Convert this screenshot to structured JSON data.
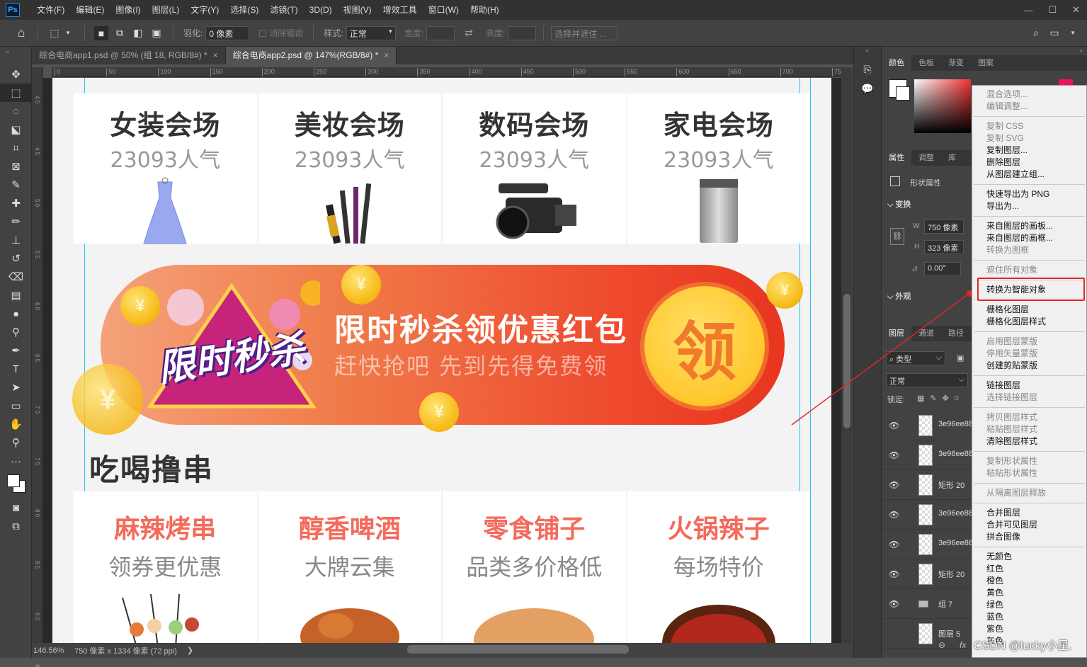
{
  "menubar": {
    "logo": "Ps",
    "items": [
      "文件(F)",
      "编辑(E)",
      "图像(I)",
      "图层(L)",
      "文字(Y)",
      "选择(S)",
      "滤镜(T)",
      "3D(D)",
      "视图(V)",
      "增效工具",
      "窗口(W)",
      "帮助(H)"
    ],
    "min": "—",
    "max": "☐",
    "close": "✕"
  },
  "options": {
    "feather_label": "羽化:",
    "feather_value": "0 像素",
    "antialias_label": "消除锯齿",
    "style_label": "样式:",
    "style_value": "正常",
    "width_label": "宽度:",
    "height_label": "高度:",
    "select_mask": "选择并遮住 ..."
  },
  "tabs": [
    {
      "label": "综合电商app1.psd @ 50% (组 18, RGB/8#) *",
      "close": "×"
    },
    {
      "label": "综合电商app2.psd @ 147%(RGB/8#) *",
      "close": "×"
    }
  ],
  "ruler_top": [
    "0",
    "50",
    "100",
    "150",
    "200",
    "250",
    "300",
    "350",
    "400",
    "450",
    "500",
    "550",
    "600",
    "650",
    "700",
    "75"
  ],
  "ruler_left": [
    "4\n0",
    "4\n5",
    "5\n0",
    "5\n5",
    "6\n0",
    "6\n5",
    "7\n0",
    "7\n5",
    "8\n0",
    "8\n5",
    "9\n0",
    "9"
  ],
  "canvas": {
    "categories": [
      {
        "title": "女装会场",
        "sub": "23093人气"
      },
      {
        "title": "美妆会场",
        "sub": "23093人气"
      },
      {
        "title": "数码会场",
        "sub": "23093人气"
      },
      {
        "title": "家电会场",
        "sub": "23093人气"
      }
    ],
    "banner": {
      "title": "限时秒杀领优惠红包",
      "sub": "赶快抢吧 先到先得免费领",
      "badge": "限时秒杀",
      "ling": "领",
      "coin": "¥"
    },
    "section_title": "吃喝撸串",
    "foods": [
      {
        "title": "麻辣烤串",
        "sub": "领券更优惠",
        "color": "#f05a4a"
      },
      {
        "title": "醇香啤酒",
        "sub": "大牌云集",
        "color": "#f05a4a"
      },
      {
        "title": "零食铺子",
        "sub": "品类多价格低",
        "color": "#f05a4a"
      },
      {
        "title": "火锅辣子",
        "sub": "每场特价",
        "color": "#f05a4a"
      }
    ]
  },
  "status": {
    "zoom": "146.56%",
    "info": "750 像素 x 1334 像素 (72 ppi)",
    "arrow": "❯"
  },
  "panels": {
    "color_tabs": [
      "颜色",
      "色板",
      "渐变",
      "图案"
    ],
    "prop_tabs": [
      "属性",
      "调整",
      "库"
    ],
    "shape_props": "形状属性",
    "transform": "变换",
    "w_label": "W",
    "w_value": "750 像素",
    "h_label": "H",
    "h_value": "323 像素",
    "angle": "0.00°",
    "appearance": "外观",
    "layer_tabs": [
      "图层",
      "通道",
      "路径"
    ],
    "filter_kind": "类型",
    "blend_mode": "正常",
    "lock_label": "锁定:",
    "layers": [
      {
        "name": "3e96ee88"
      },
      {
        "name": "3e96ee88"
      },
      {
        "name": "矩形 20"
      },
      {
        "name": "3e96ee88"
      },
      {
        "name": "3e96ee88"
      },
      {
        "name": "矩形 20"
      },
      {
        "name": "组 7"
      },
      {
        "name": "图层 5"
      }
    ]
  },
  "context_menu": [
    {
      "label": "混合选项...",
      "disabled": true
    },
    {
      "label": "编辑调整...",
      "disabled": true
    },
    {
      "sep": true
    },
    {
      "label": "复制 CSS",
      "disabled": true
    },
    {
      "label": "复制 SVG",
      "disabled": true
    },
    {
      "label": "复制图层...",
      "disabled": false
    },
    {
      "label": "删除图层",
      "disabled": false
    },
    {
      "label": "从图层建立组...",
      "disabled": false
    },
    {
      "sep": true
    },
    {
      "label": "快速导出为 PNG",
      "disabled": false
    },
    {
      "label": "导出为...",
      "disabled": false
    },
    {
      "sep": true
    },
    {
      "label": "来自图层的画板...",
      "disabled": false
    },
    {
      "label": "来自图层的画框...",
      "disabled": false
    },
    {
      "label": "转换为图框",
      "disabled": true
    },
    {
      "sep": true
    },
    {
      "label": "遮住所有对象",
      "disabled": true
    },
    {
      "sep": true
    },
    {
      "label": "转换为智能对象",
      "disabled": false
    },
    {
      "sep": true
    },
    {
      "label": "栅格化图层",
      "disabled": false
    },
    {
      "label": "栅格化图层样式",
      "disabled": false
    },
    {
      "sep": true
    },
    {
      "label": "启用图层蒙版",
      "disabled": true
    },
    {
      "label": "停用矢量蒙版",
      "disabled": true
    },
    {
      "label": "创建剪贴蒙版",
      "disabled": false
    },
    {
      "sep": true
    },
    {
      "label": "链接图层",
      "disabled": false
    },
    {
      "label": "选择链接图层",
      "disabled": true
    },
    {
      "sep": true
    },
    {
      "label": "拷贝图层样式",
      "disabled": true
    },
    {
      "label": "粘贴图层样式",
      "disabled": true
    },
    {
      "label": "清除图层样式",
      "disabled": false
    },
    {
      "sep": true
    },
    {
      "label": "复制形状属性",
      "disabled": true
    },
    {
      "label": "粘贴形状属性",
      "disabled": true
    },
    {
      "sep": true
    },
    {
      "label": "从隔离图层释放",
      "disabled": true
    },
    {
      "sep": true
    },
    {
      "label": "合并图层",
      "disabled": false
    },
    {
      "label": "合并可见图层",
      "disabled": false
    },
    {
      "label": "拼合图像",
      "disabled": false
    },
    {
      "sep": true
    },
    {
      "label": "无颜色",
      "disabled": false
    },
    {
      "label": "红色",
      "disabled": false
    },
    {
      "label": "橙色",
      "disabled": false
    },
    {
      "label": "黄色",
      "disabled": false
    },
    {
      "label": "绿色",
      "disabled": false
    },
    {
      "label": "蓝色",
      "disabled": false
    },
    {
      "label": "紫色",
      "disabled": false
    },
    {
      "label": "灰色",
      "disabled": false
    }
  ],
  "watermark": "CSDN @lucky小星.",
  "colors": {
    "accent": "#e3262b",
    "guide": "#24c7e8",
    "banner_start": "#f5a27a",
    "banner_end": "#e8351f"
  }
}
